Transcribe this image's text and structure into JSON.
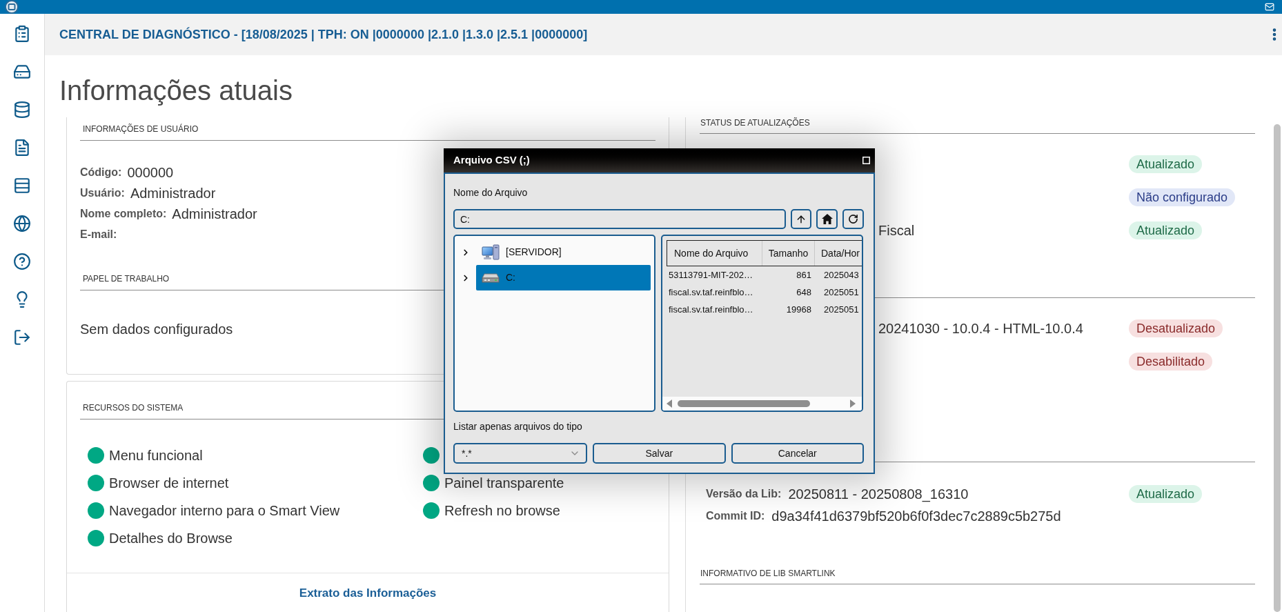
{
  "header": {
    "title": "CENTRAL DE DIAGNÓSTICO - [18/08/2025 | TPH: ON |0000000 |2.1.0 |1.3.0 |2.5.1 |0000000]"
  },
  "page": {
    "title": "Informações atuais"
  },
  "user_info": {
    "title": "INFORMAÇÕES DE USUÁRIO",
    "fields": [
      {
        "label": "Código:",
        "value": "000000"
      },
      {
        "label": "Usuário:",
        "value": "Administrador"
      },
      {
        "label": "Nome completo:",
        "value": "Administrador"
      },
      {
        "label": "E-mail:"
      }
    ]
  },
  "work_paper": {
    "title": "PAPEL DE TRABALHO",
    "message": "Sem dados configurados"
  },
  "system_resources": {
    "title": "RECURSOS DO SISTEMA",
    "columns": [
      [
        {
          "label": "Menu funcional",
          "on": true
        },
        {
          "label": "Browser de internet",
          "on": true
        },
        {
          "label": "Navegador interno para o Smart View",
          "on": true
        },
        {
          "label": "Detalhes do Browse",
          "on": true
        }
      ],
      [
        {
          "on": true
        },
        {
          "label": "Painel transparente",
          "on": true
        },
        {
          "label": "Refresh no browse",
          "on": true
        }
      ]
    ],
    "link": "Extrato das Informações"
  },
  "status_panel": {
    "sections": [
      {
        "kind": "status",
        "title": "STATUS DE ATUALIZAÇÕES",
        "rows": [
          {
            "status": {
              "kind": "ok",
              "label": "Atualizado"
            }
          },
          {
            "status": {
              "kind": "info",
              "label": "Não configurado"
            }
          },
          {
            "value": "Fiscal",
            "status": {
              "kind": "ok",
              "label": "Atualizado"
            }
          }
        ]
      },
      {
        "kind": "status",
        "rows": [
          {
            "value": "20241030 - 10.0.4 - HTML-10.0.4",
            "status": {
              "kind": "error",
              "label": "Desatualizado"
            }
          },
          {
            "status": {
              "kind": "error",
              "label": "Desabilitado"
            }
          }
        ]
      },
      {
        "kind": "lib",
        "fields": [
          {
            "label": "Versão da Lib:",
            "value": "20250811 - 20250808_16310"
          },
          {
            "label": "Commit ID:",
            "value": "d9a34f41d6379bf520b6f0f3dec7c2889c5b275d"
          }
        ],
        "status": {
          "kind": "ok",
          "label": "Atualizado"
        }
      },
      {
        "kind": "heading",
        "title": "INFORMATIVO DE LIB SMARTLINK"
      }
    ]
  },
  "dialog": {
    "title": "Arquivo CSV (;)",
    "filename_label": "Nome do Arquivo",
    "path": {
      "value": "C:"
    },
    "tree": [
      {
        "label": "[SERVIDOR]",
        "kind": "computer",
        "expanded": false,
        "selected": false
      },
      {
        "label": "C:",
        "kind": "drive",
        "expanded": false,
        "selected": true
      }
    ],
    "files": {
      "columns": [
        "Nome do Arquivo",
        "Tamanho",
        "Data/Hor"
      ],
      "rows": [
        {
          "name": "53113791-MIT-202…",
          "size": "861",
          "date": "2025043"
        },
        {
          "name": "fiscal.sv.taf.reinfblo…",
          "size": "648",
          "date": "2025051"
        },
        {
          "name": "fiscal.sv.taf.reinfblo…",
          "size": "19968",
          "date": "2025051"
        }
      ]
    },
    "filter_label": "Listar apenas arquivos do tipo",
    "filter": {
      "value": "*.*"
    },
    "buttons": [
      "Salvar",
      "Cancelar"
    ]
  }
}
